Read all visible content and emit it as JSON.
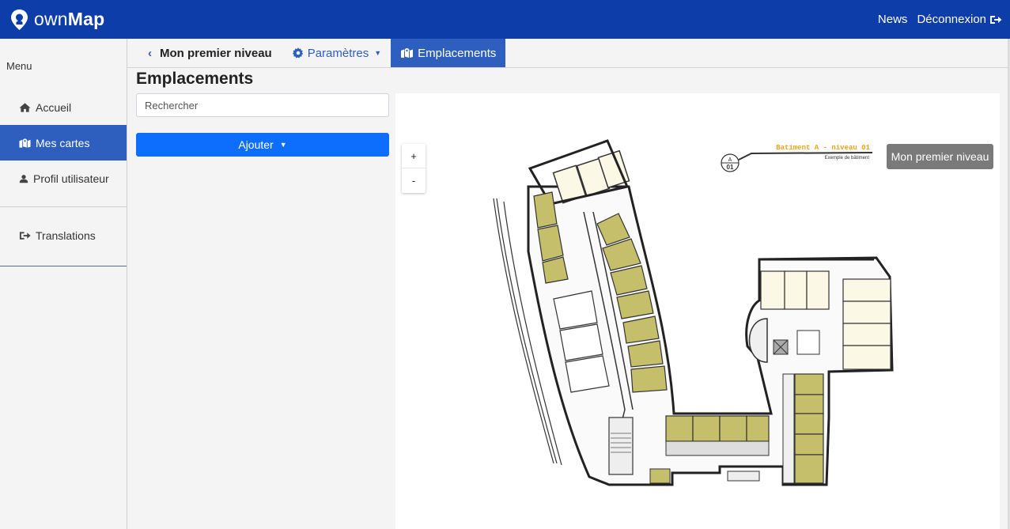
{
  "navbar": {
    "brand_prefix": "own",
    "brand_bold": "Map",
    "news": "News",
    "logout": "Déconnexion",
    "color": "#0c3da8"
  },
  "sidebar": {
    "menu_title": "Menu",
    "items": [
      {
        "label": "Accueil",
        "icon": "home-icon"
      },
      {
        "label": "Mes cartes",
        "icon": "map-icon",
        "active": true
      },
      {
        "label": "Profil utilisateur",
        "icon": "user-icon"
      },
      {
        "label": "Translations",
        "icon": "sign-out-icon"
      }
    ]
  },
  "subbar": {
    "level_title": "Mon premier niveau",
    "tab_settings": "Paramètres",
    "tab_locations": "Emplacements"
  },
  "main": {
    "page_title": "Emplacements",
    "search_placeholder": "Rechercher",
    "add_button": "Ajouter"
  },
  "map": {
    "zoom_in": "+",
    "zoom_out": "-",
    "level_chip": "Mon premier niveau",
    "plan_title": "Batiment A - niveau 01",
    "plan_subtitle": "Exemple de bâtiment",
    "badge_top": "A",
    "badge_bottom": "01",
    "room_color": "#c5be6a"
  }
}
